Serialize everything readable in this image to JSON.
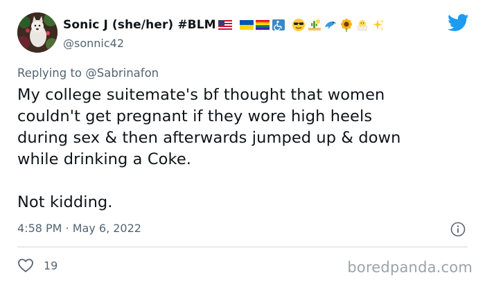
{
  "author": {
    "display_name": "Sonic J (she/her) #BLM",
    "handle": "@sonnic42",
    "emojis": [
      "us-flag",
      "ukraine-flag",
      "rainbow-flag",
      "wheelchair-symbol",
      "sunglasses-face",
      "desert-cactus",
      "dolphin",
      "sunflower",
      "hatching-chick",
      "sparkles"
    ]
  },
  "reply": {
    "prefix": "Replying to ",
    "mention": "@Sabrinafon"
  },
  "tweet": {
    "lines": [
      "My college suitemate's bf thought that women",
      "couldn't get pregnant if they wore high heels",
      "during sex & then afterwards jumped up & down",
      "while drinking a Coke.",
      "Not kidding."
    ]
  },
  "meta": {
    "timestamp": "4:58 PM · May 6, 2022"
  },
  "engagement": {
    "likes": "19"
  },
  "watermark": "boredpanda.com",
  "colors": {
    "twitter_blue": "#1d9bf0",
    "secondary_text": "#536471",
    "primary_text": "#0f1419",
    "divider": "#cfd9de"
  }
}
